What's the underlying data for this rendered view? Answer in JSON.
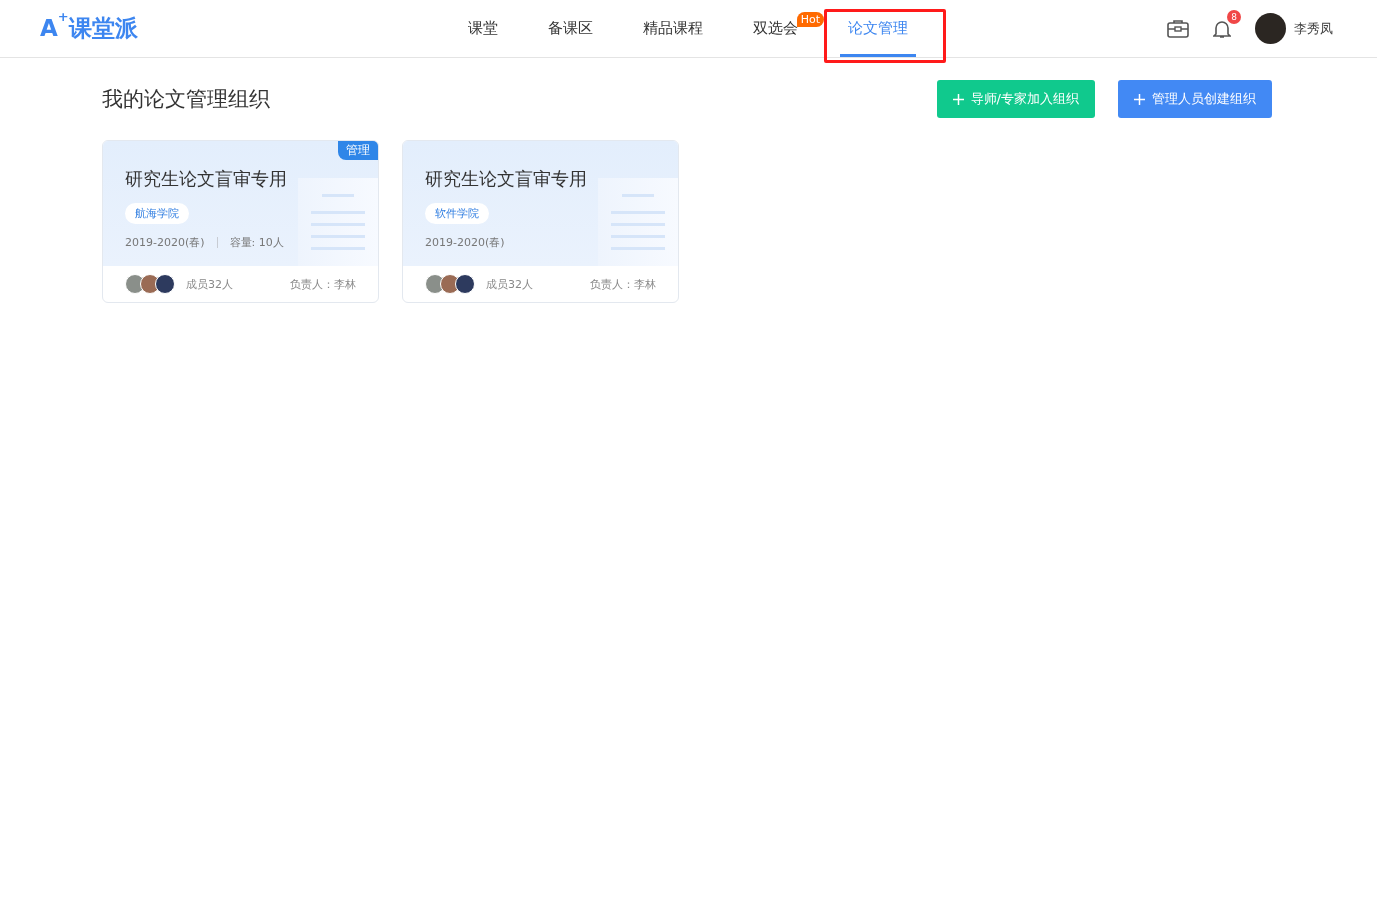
{
  "logo": "A$^{+}$课堂派",
  "nav": [
    {
      "label": "课堂",
      "selected": false
    },
    {
      "label": "备课区",
      "selected": false
    },
    {
      "label": "精品课程",
      "selected": false
    },
    {
      "label": "双选会",
      "selected": false,
      "badge": "Hot"
    },
    {
      "label": "论文管理",
      "selected": true
    }
  ],
  "notifications": {
    "count": "8"
  },
  "user": {
    "name": "李秀凤"
  },
  "page_title": "我的论文管理组织",
  "buttons": [
    {
      "label": "导师/专家加入组织",
      "kind": "join"
    },
    {
      "label": "管理人员创建组织",
      "kind": "create"
    }
  ],
  "cards": [
    {
      "title": "研究生论文盲审专用",
      "tag": "航海学院",
      "term": "2019-2020(春)",
      "capacity": "容量: 10人",
      "badge": "管理",
      "members": "成员32人",
      "owner": "负责人：李林"
    },
    {
      "title": "研究生论文盲审专用",
      "tag": "软件学院",
      "term": "2019-2020(春)",
      "members": "成员32人",
      "owner": "负责人：李林"
    }
  ]
}
